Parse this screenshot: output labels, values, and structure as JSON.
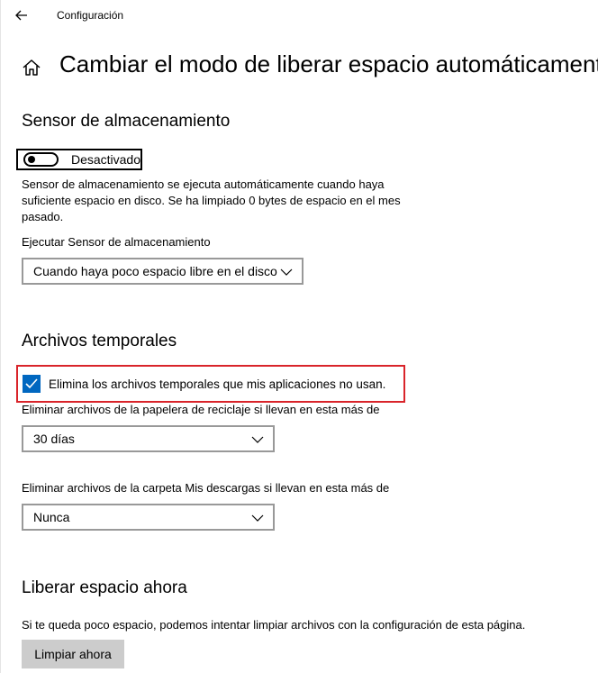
{
  "window": {
    "title": "Configuración"
  },
  "page": {
    "title": "Cambiar el modo de liberar espacio automáticamente"
  },
  "storage_sense": {
    "heading": "Sensor de almacenamiento",
    "toggle_state_label": "Desactivado",
    "toggle_on": false,
    "description": "Sensor de almacenamiento se ejecuta automáticamente cuando haya suficiente espacio en disco. Se ha limpiado 0 bytes de espacio en el mes pasado.",
    "run_label": "Ejecutar Sensor de almacenamiento",
    "run_value": "Cuando haya poco espacio libre en el disco"
  },
  "temp_files": {
    "heading": "Archivos temporales",
    "checkbox_label": "Elimina los archivos temporales que mis aplicaciones no usan.",
    "checkbox_checked": true,
    "recycle_label": "Eliminar archivos de la papelera de reciclaje si llevan en esta más de",
    "recycle_value": "30 días",
    "downloads_label": "Eliminar archivos de la carpeta Mis descargas si llevan en esta más de",
    "downloads_value": "Nunca"
  },
  "free_now": {
    "heading": "Liberar espacio ahora",
    "description": "Si te queda poco espacio, podemos intentar limpiar archivos con la configuración de esta página.",
    "button_label": "Limpiar ahora"
  },
  "icons": {
    "back": "arrow-left-icon",
    "home": "home-icon",
    "chevron": "chevron-down-icon",
    "check": "checkmark-icon"
  },
  "colors": {
    "accent": "#0067c0",
    "highlight": "#d9242a",
    "button": "#cccccc"
  }
}
